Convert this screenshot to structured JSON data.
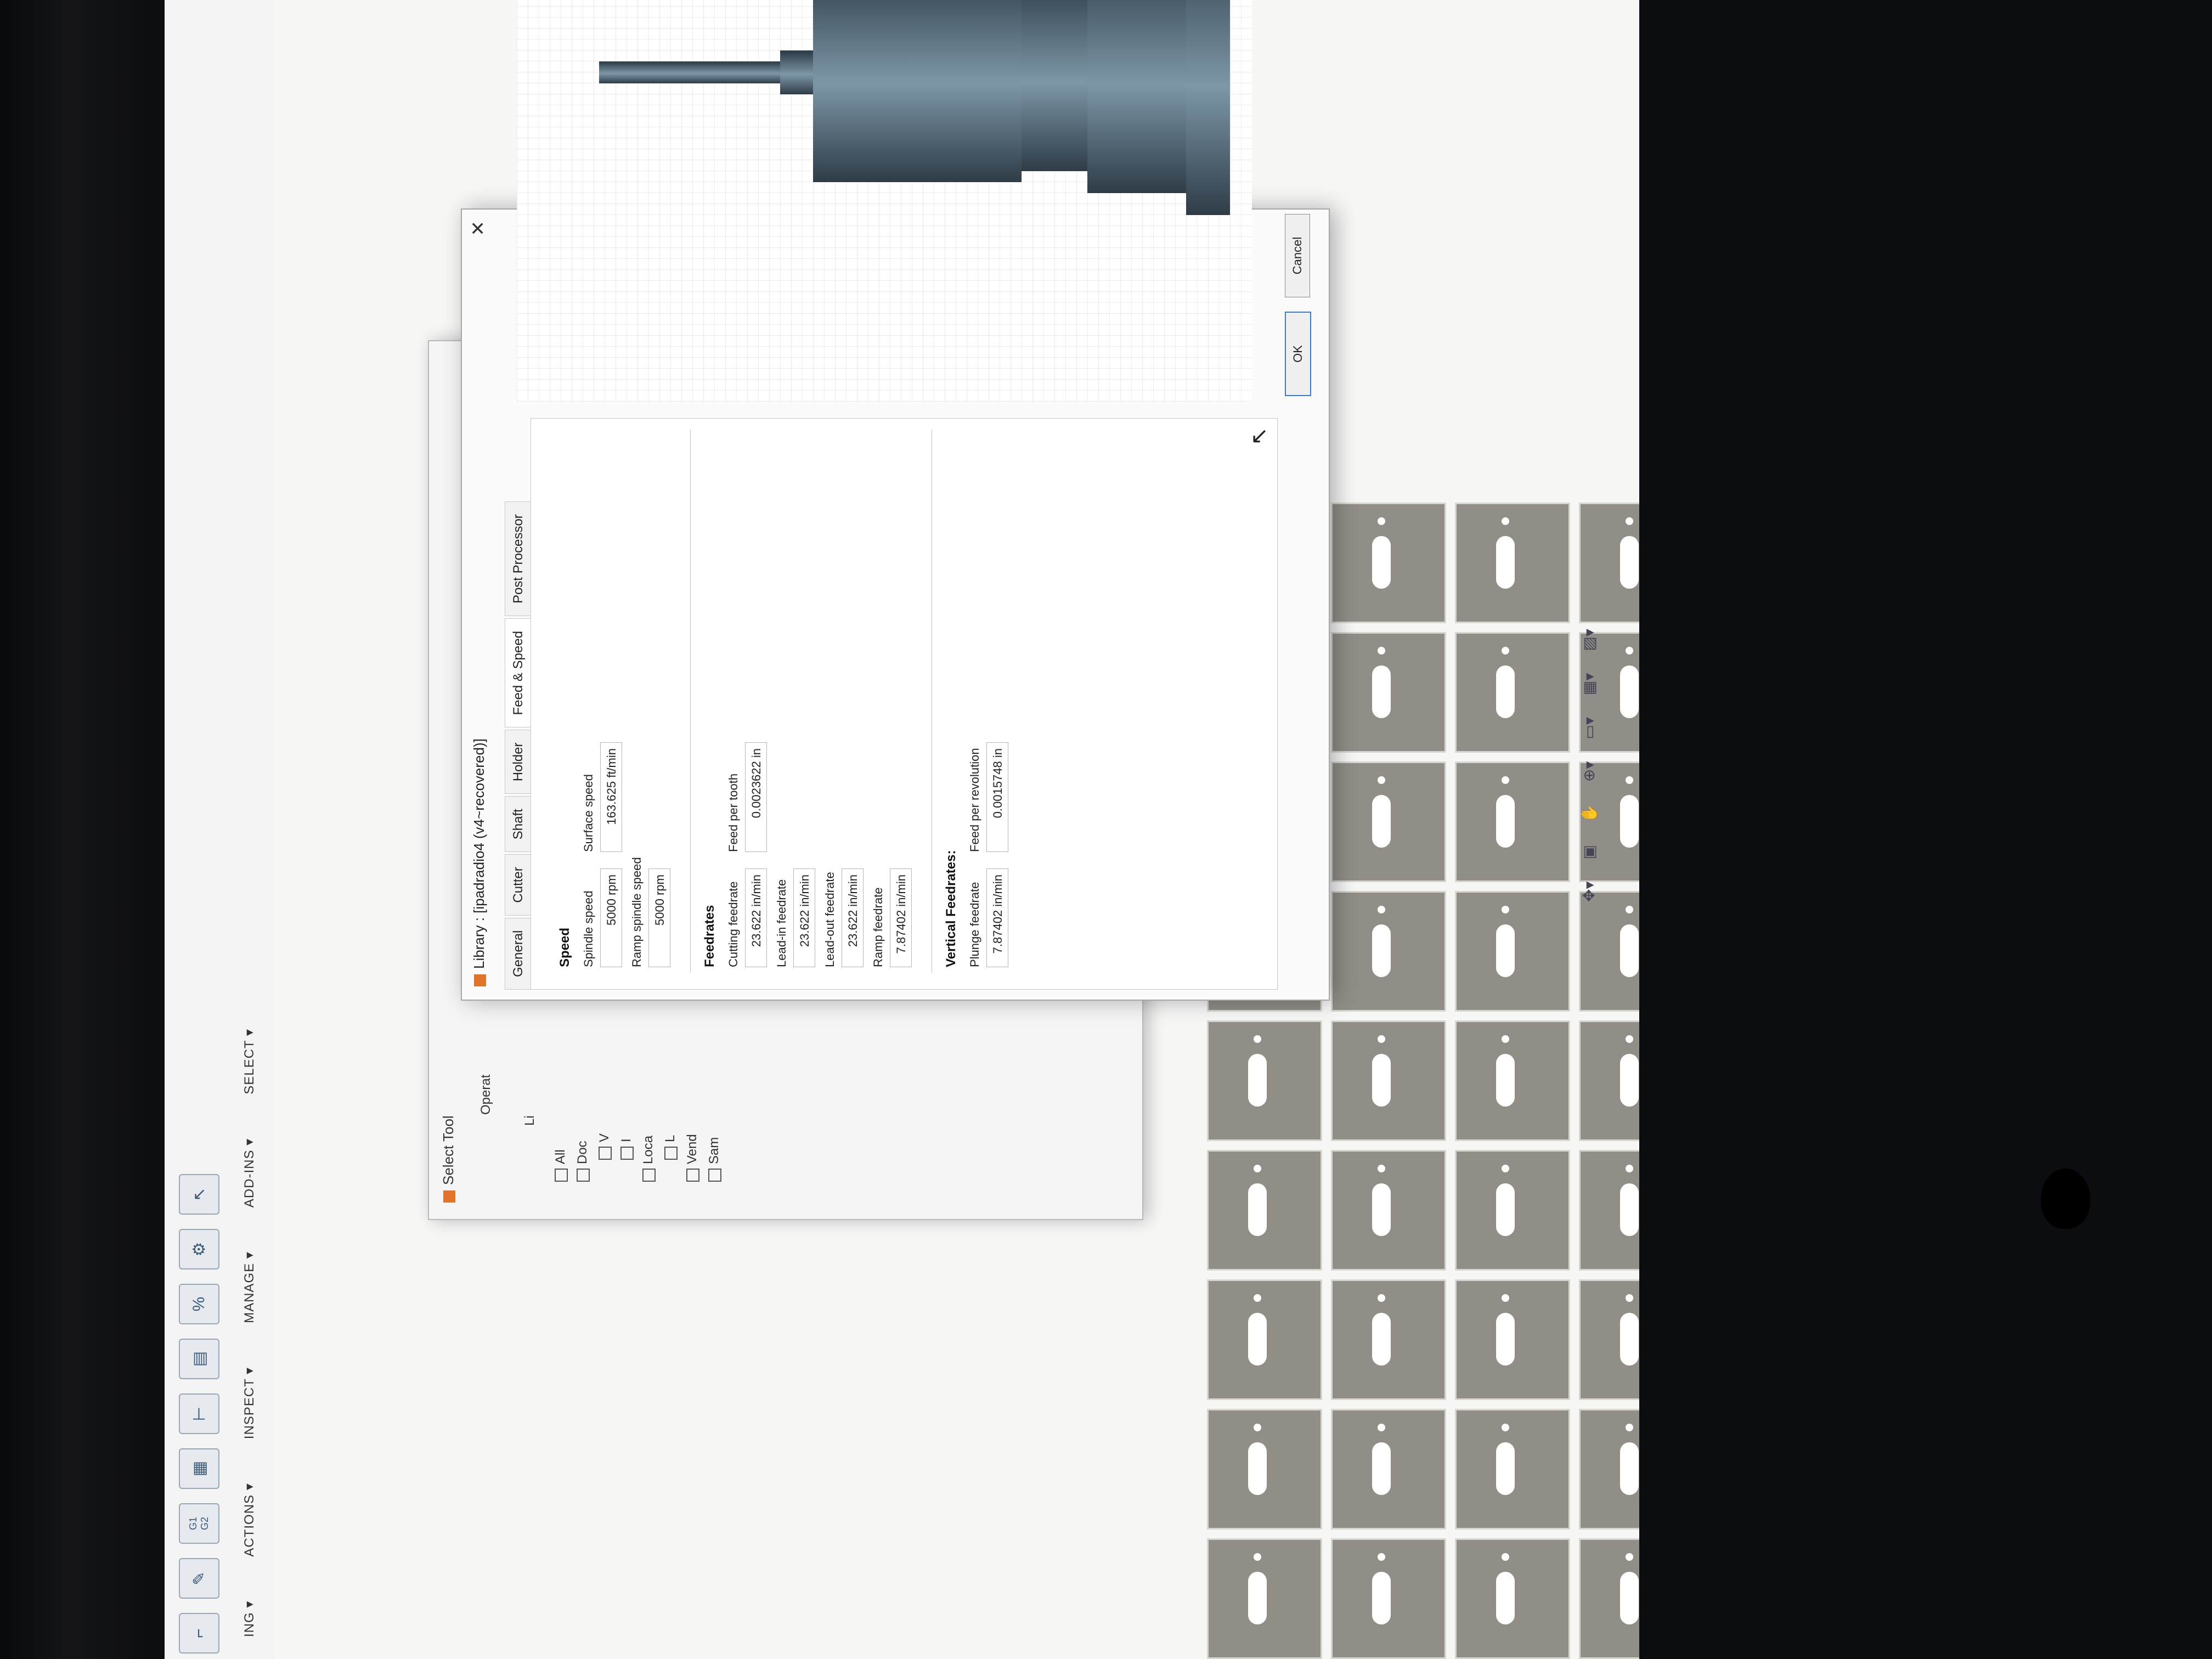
{
  "ribbon": {
    "menus": [
      "ING ▾",
      "ACTIONS ▾",
      "INSPECT ▾",
      "MANAGE ▾",
      "ADD-INS ▾",
      "SELECT ▾"
    ],
    "icon_labels": [
      "G1\nG2",
      "%"
    ]
  },
  "select_tool": {
    "title": "Select Tool",
    "operation_label": "Operat",
    "library_label": "Li",
    "tree": [
      "All",
      "Doc",
      "V",
      "I",
      "Loca",
      "L",
      "Vend",
      "Sam"
    ]
  },
  "library": {
    "title": "Library : [ipadradio4 (v4~recovered)]",
    "tabs": [
      "General",
      "Cutter",
      "Shaft",
      "Holder",
      "Feed & Speed",
      "Post Processor"
    ],
    "active_tab": "Feed & Speed",
    "speed": {
      "title": "Speed",
      "spindle_speed_label": "Spindle speed",
      "spindle_speed": "5000 rpm",
      "surface_speed_label": "Surface speed",
      "surface_speed": "163.625 ft/min",
      "ramp_spindle_speed_label": "Ramp spindle speed",
      "ramp_spindle_speed": "5000 rpm"
    },
    "feedrates": {
      "title": "Feedrates",
      "cutting_feedrate_label": "Cutting feedrate",
      "cutting_feedrate": "23.622 in/min",
      "feed_per_tooth_label": "Feed per tooth",
      "feed_per_tooth": "0.0023622 in",
      "lead_in_feedrate_label": "Lead-in feedrate",
      "lead_in_feedrate": "23.622 in/min",
      "lead_out_feedrate_label": "Lead-out feedrate",
      "lead_out_feedrate": "23.622 in/min",
      "ramp_feedrate_label": "Ramp feedrate",
      "ramp_feedrate": "7.87402 in/min"
    },
    "vertical_feedrates": {
      "title": "Vertical Feedrates:",
      "plunge_feedrate_label": "Plunge feedrate",
      "plunge_feedrate": "7.87402 in/min",
      "feed_per_revolution_label": "Feed per revolution",
      "feed_per_revolution": "0.0015748 in"
    },
    "ok_label": "OK",
    "cancel_label": "Cancel"
  },
  "colors": {
    "ribbon_blue": "#4e7fa8",
    "part_gray": "#918e88",
    "dialog_logo": "#e2742a",
    "tool_steel": "#5c7586"
  }
}
